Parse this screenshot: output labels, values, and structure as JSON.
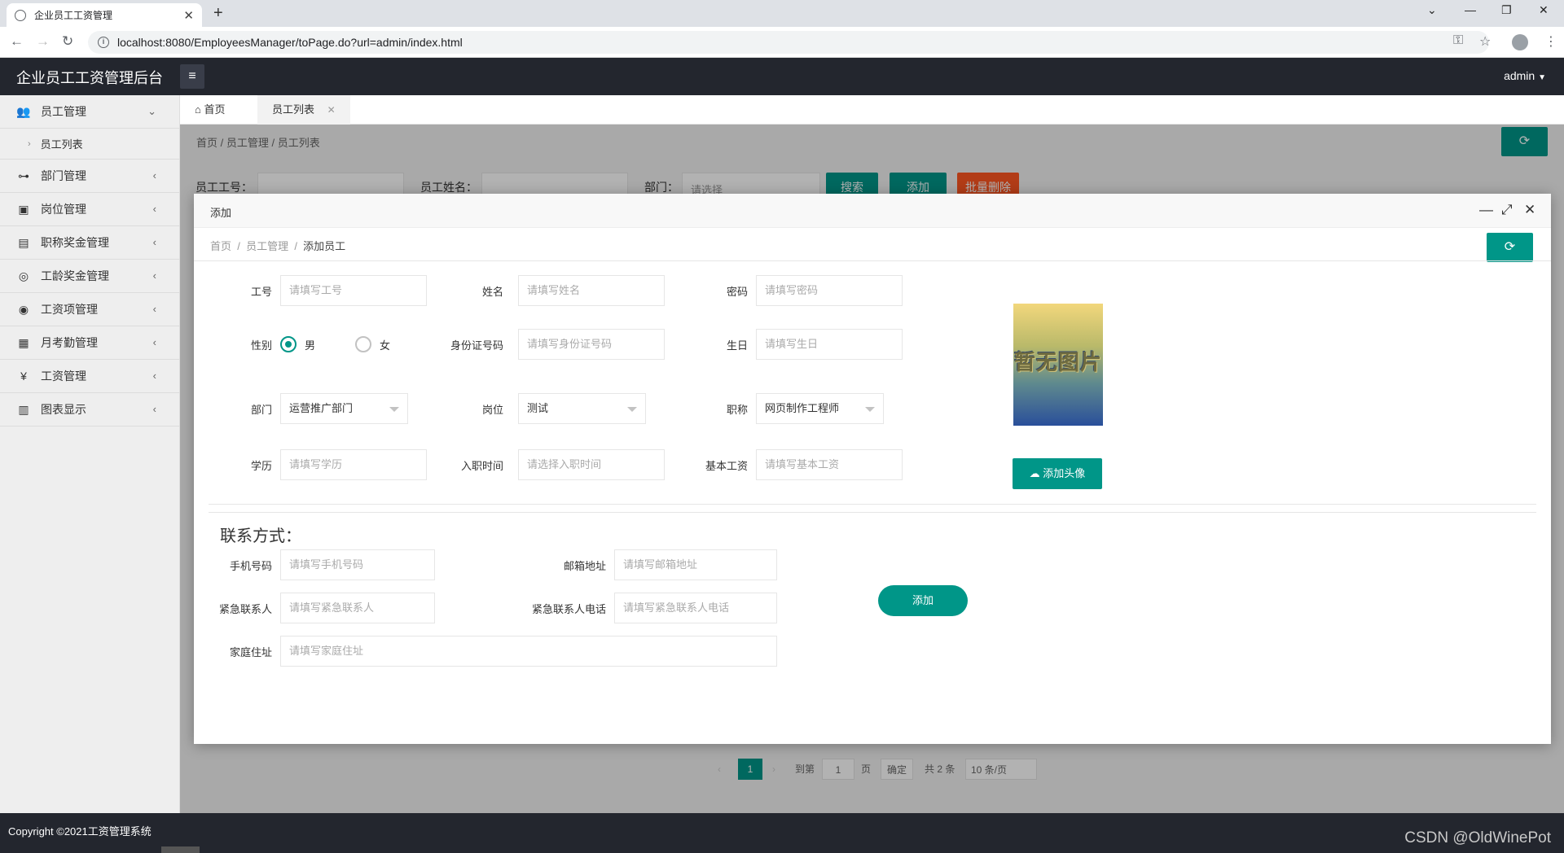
{
  "browser": {
    "tab_title": "企业员工工资管理",
    "url": "localhost:8080/EmployeesManager/toPage.do?url=admin/index.html"
  },
  "app": {
    "title": "企业员工工资管理后台",
    "user": "admin",
    "copyright": "Copyright ©2021工资管理系统",
    "watermark": "CSDN @OldWinePot"
  },
  "sidebar": {
    "items": [
      {
        "label": "员工管理",
        "icon": "user-group-icon"
      },
      {
        "label": "部门管理",
        "icon": "org-chart-icon"
      },
      {
        "label": "岗位管理",
        "icon": "badge-icon"
      },
      {
        "label": "职称奖金管理",
        "icon": "briefcase-icon"
      },
      {
        "label": "工龄奖金管理",
        "icon": "medal-icon"
      },
      {
        "label": "工资项管理",
        "icon": "coin-icon"
      },
      {
        "label": "月考勤管理",
        "icon": "calendar-icon"
      },
      {
        "label": "工资管理",
        "icon": "money-icon"
      },
      {
        "label": "图表显示",
        "icon": "bar-chart-icon"
      }
    ],
    "sub_items": [
      "员工列表"
    ]
  },
  "page_tabs": [
    "首页",
    "员工列表"
  ],
  "background": {
    "breadcrumb": [
      "首页",
      "员工管理",
      "员工列表"
    ],
    "search": {
      "emp_no_label": "员工工号：",
      "name_label": "员工姓名：",
      "dept_label": "部门：",
      "dept_placeholder": "请选择",
      "search_btn": "搜索",
      "add_btn": "添加",
      "batch_delete_btn": "批量删除"
    },
    "pager": {
      "current": "1",
      "goto_label": "到第",
      "goto_value": "1",
      "page_label": "页",
      "confirm": "确定",
      "total": "共 2 条",
      "page_size": "10 条/页"
    }
  },
  "modal": {
    "title": "添加",
    "breadcrumb": [
      "首页",
      "员工管理",
      "添加员工"
    ],
    "fields": {
      "emp_no": {
        "label": "工号",
        "placeholder": "请填写工号"
      },
      "name": {
        "label": "姓名",
        "placeholder": "请填写姓名"
      },
      "password": {
        "label": "密码",
        "placeholder": "请填写密码"
      },
      "gender": {
        "label": "性别",
        "options": [
          "男",
          "女"
        ],
        "selected": "男"
      },
      "id_card": {
        "label": "身份证号码",
        "placeholder": "请填写身份证号码"
      },
      "birthday": {
        "label": "生日",
        "placeholder": "请填写生日"
      },
      "dept": {
        "label": "部门",
        "value": "运营推广部门"
      },
      "post": {
        "label": "岗位",
        "value": "测试"
      },
      "title": {
        "label": "职称",
        "value": "网页制作工程师"
      },
      "education": {
        "label": "学历",
        "placeholder": "请填写学历"
      },
      "hire_date": {
        "label": "入职时间",
        "placeholder": "请选择入职时间"
      },
      "base_salary": {
        "label": "基本工资",
        "placeholder": "请填写基本工资"
      }
    },
    "avatar": {
      "placeholder_text": "暂无图片",
      "upload_btn": "添加头像"
    },
    "contact": {
      "section_title": "联系方式：",
      "phone": {
        "label": "手机号码",
        "placeholder": "请填写手机号码"
      },
      "email": {
        "label": "邮箱地址",
        "placeholder": "请填写邮箱地址"
      },
      "emergency": {
        "label": "紧急联系人",
        "placeholder": "请填写紧急联系人"
      },
      "emergency_phone": {
        "label": "紧急联系人电话",
        "placeholder": "请填写紧急联系人电话"
      },
      "address": {
        "label": "家庭住址",
        "placeholder": "请填写家庭住址"
      }
    },
    "submit_btn": "添加"
  },
  "colors": {
    "accent": "#009688",
    "header_bg": "#23262e",
    "danger": "#ff5722"
  }
}
